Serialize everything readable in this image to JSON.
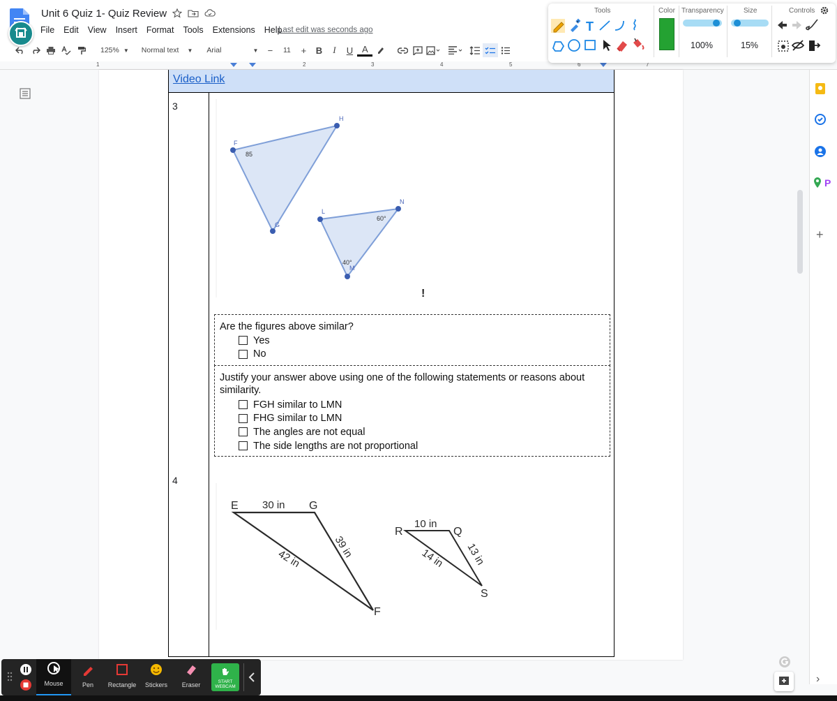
{
  "doc": {
    "title": "Unit 6 Quiz 1- Quiz Review",
    "menu": [
      "File",
      "Edit",
      "View",
      "Insert",
      "Format",
      "Tools",
      "Extensions",
      "Help"
    ],
    "last_edit": "Last edit was seconds ago"
  },
  "toolbar": {
    "zoom": "125%",
    "style": "Normal text",
    "font": "Arial",
    "font_size": "11",
    "minus": "−",
    "plus": "+",
    "bold": "B",
    "italic": "I",
    "underline": "U",
    "text_color": "A"
  },
  "ruler": {
    "marks": [
      "1",
      "2",
      "3",
      "4",
      "5",
      "6",
      "7"
    ]
  },
  "annotation": {
    "tools_label": "Tools",
    "color_label": "Color",
    "transparency_label": "Transparency",
    "size_label": "Size",
    "controls_label": "Controls",
    "transparency_value": "100%",
    "size_value": "15%",
    "current_color": "#24a232"
  },
  "content": {
    "video_link": "Video Link",
    "q3": {
      "number": "3",
      "labels": {
        "F": "F",
        "H": "H",
        "G": "G",
        "L": "L",
        "N": "N",
        "M": "M"
      },
      "angle_f": "85",
      "angle_n": "60°",
      "angle_m": "40°",
      "cursor_mark": "!",
      "question": "Are the figures above similar?",
      "options": [
        "Yes",
        "No"
      ],
      "justify": "Justify your answer above using one of the following statements or reasons about similarity.",
      "reasons": [
        "FGH similar to LMN",
        "FHG similar to LMN",
        "The angles are not equal",
        "The side lengths are not proportional"
      ]
    },
    "q4": {
      "number": "4",
      "labels": {
        "E": "E",
        "G": "G",
        "F": "F",
        "R": "R",
        "Q": "Q",
        "S": "S"
      },
      "side_eg": "30 in",
      "side_gf": "39 in",
      "side_ef": "42 in",
      "side_rq": "10 in",
      "side_qs": "13 in",
      "side_rs": "14 in"
    }
  },
  "bottom_toolbar": {
    "items": [
      "Mouse",
      "Pen",
      "Rectangle",
      "Stickers",
      "Eraser"
    ],
    "webcam_line1": "START",
    "webcam_line2": "WEBCAM"
  },
  "sidepanel": {
    "add": "+",
    "chevron": "›"
  }
}
